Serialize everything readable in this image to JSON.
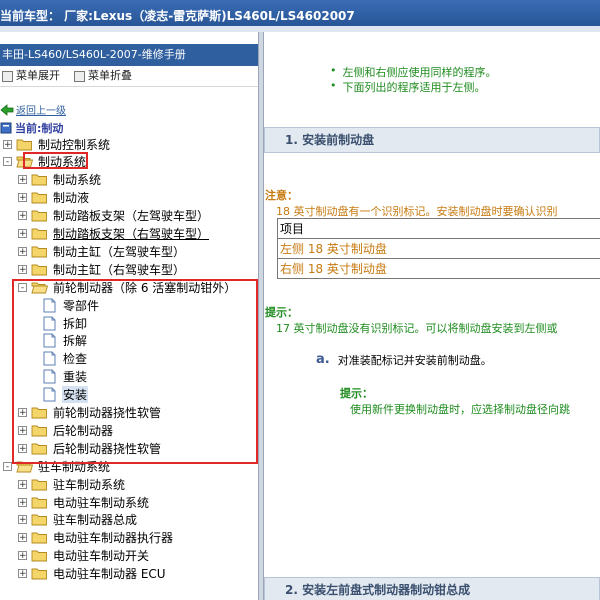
{
  "window": {
    "title": "当前车型： 厂家:Lexus（凌志-雷克萨斯)LS460L/LS4602007"
  },
  "left_panel": {
    "book_title": "丰田-LS460/LS460L-2007-维修手册",
    "tools": {
      "expand_label": "菜单展开",
      "collapse_label": "菜单折叠"
    },
    "back_link": "返回上一级",
    "current": "当前:制动",
    "tree": [
      {
        "label": "制动控制系统",
        "level": 0,
        "expander": "+",
        "icon": "folder-icon",
        "underline": false
      },
      {
        "label": "制动系统",
        "level": 0,
        "expander": "-",
        "icon": "folder-open-icon",
        "underline": false
      },
      {
        "label": "制动系统",
        "level": 1,
        "expander": "+",
        "icon": "folder-icon",
        "underline": false
      },
      {
        "label": "制动液",
        "level": 1,
        "expander": "+",
        "icon": "folder-icon",
        "underline": false
      },
      {
        "label": "制动踏板支架（左驾驶车型）",
        "level": 1,
        "expander": "+",
        "icon": "folder-icon",
        "underline": false
      },
      {
        "label": "制动踏板支架（右驾驶车型）",
        "level": 1,
        "expander": "+",
        "icon": "folder-icon",
        "underline": true
      },
      {
        "label": "制动主缸（左驾驶车型）",
        "level": 1,
        "expander": "+",
        "icon": "folder-icon",
        "underline": false
      },
      {
        "label": "制动主缸（右驾驶车型）",
        "level": 1,
        "expander": "+",
        "icon": "folder-icon",
        "underline": false
      },
      {
        "label": "前轮制动器（除 6 活塞制动钳外）",
        "level": 1,
        "expander": "-",
        "icon": "folder-open-icon",
        "underline": false
      },
      {
        "label": "零部件",
        "level": 2,
        "expander": "",
        "icon": "page-icon",
        "underline": false
      },
      {
        "label": "拆卸",
        "level": 2,
        "expander": "",
        "icon": "page-icon",
        "underline": false
      },
      {
        "label": "拆解",
        "level": 2,
        "expander": "",
        "icon": "page-icon",
        "underline": false
      },
      {
        "label": "检查",
        "level": 2,
        "expander": "",
        "icon": "page-icon",
        "underline": false
      },
      {
        "label": "重装",
        "level": 2,
        "expander": "",
        "icon": "page-icon",
        "underline": false
      },
      {
        "label": "安装",
        "level": 2,
        "expander": "",
        "icon": "page-icon",
        "underline": false,
        "selected": true
      },
      {
        "label": "前轮制动器挠性软管",
        "level": 1,
        "expander": "+",
        "icon": "folder-icon",
        "underline": false
      },
      {
        "label": "后轮制动器",
        "level": 1,
        "expander": "+",
        "icon": "folder-icon",
        "underline": false
      },
      {
        "label": "后轮制动器挠性软管",
        "level": 1,
        "expander": "+",
        "icon": "folder-icon",
        "underline": false
      },
      {
        "label": "驻车制动系统",
        "level": 0,
        "expander": "-",
        "icon": "folder-open-icon",
        "underline": false
      },
      {
        "label": "驻车制动系统",
        "level": 1,
        "expander": "+",
        "icon": "folder-icon",
        "underline": false
      },
      {
        "label": "电动驻车制动系统",
        "level": 1,
        "expander": "+",
        "icon": "folder-icon",
        "underline": false
      },
      {
        "label": "驻车制动器总成",
        "level": 1,
        "expander": "+",
        "icon": "folder-icon",
        "underline": false
      },
      {
        "label": "电动驻车制动器执行器",
        "level": 1,
        "expander": "+",
        "icon": "folder-icon",
        "underline": false
      },
      {
        "label": "电动驻车制动开关",
        "level": 1,
        "expander": "+",
        "icon": "folder-icon",
        "underline": false
      },
      {
        "label": "电动驻车制动器 ECU",
        "level": 1,
        "expander": "+",
        "icon": "folder-icon",
        "underline": false
      }
    ]
  },
  "content": {
    "bullets": [
      "左侧和右侧应使用同样的程序。",
      "下面列出的程序适用于左侧。"
    ],
    "section1": "1. 安装前制动盘",
    "note": {
      "heading": "注意：",
      "text": "18 英寸制动盘有一个识别标记。安装制动盘时要确认识别",
      "table": [
        "项目",
        "左侧 18 英寸制动盘",
        "右侧 18 英寸制动盘"
      ]
    },
    "hint1": {
      "heading": "提示：",
      "text": "17 英寸制动盘没有识别标记。可以将制动盘安装到左侧或"
    },
    "step": {
      "num": "a.",
      "text": "对准装配标记并安装前制动盘。"
    },
    "hint2": {
      "heading": "提示：",
      "text": "使用新件更换制动盘时，应选择制动盘径向跳"
    },
    "section2": "2. 安装左前盘式制动器制动钳总成"
  },
  "colors": {
    "accent": "#2f5f9e",
    "note": "#c77a10",
    "hint": "#1f8c1f",
    "highlight": "#e02828"
  }
}
